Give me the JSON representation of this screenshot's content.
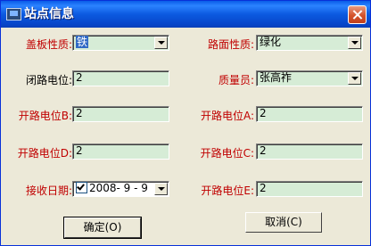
{
  "window": {
    "title": "站点信息"
  },
  "fields": {
    "cover_material": {
      "label": "盖板性质:",
      "value": "铁"
    },
    "road_surface": {
      "label": "路面性质:",
      "value": "绿化"
    },
    "closed_potential": {
      "label": "闭路电位:",
      "value": "2"
    },
    "inspector": {
      "label": "质量员:",
      "value": "张高祚"
    },
    "open_potential_b": {
      "label": "开路电位B:",
      "value": "2"
    },
    "open_potential_a": {
      "label": "开路电位A:",
      "value": "2"
    },
    "open_potential_d": {
      "label": "开路电位D:",
      "value": "2"
    },
    "open_potential_c": {
      "label": "开路电位C:",
      "value": "2"
    },
    "receive_date": {
      "label": "接收日期:",
      "value": "2008- 9 - 9",
      "checked": true
    },
    "open_potential_e": {
      "label": "开路电位E:",
      "value": "2"
    }
  },
  "buttons": {
    "ok": "确定(O)",
    "cancel": "取消(C)"
  },
  "icons": {
    "app": "window-app-icon",
    "close": "close-icon",
    "dropdown": "chevron-down-icon",
    "checkbox": "checkbox-checked-icon"
  },
  "colors": {
    "label_red": "#c00000",
    "field_bg": "#d6ecd6",
    "titlebar": "#0a5ce8",
    "dialog_bg": "#ece9d8"
  }
}
